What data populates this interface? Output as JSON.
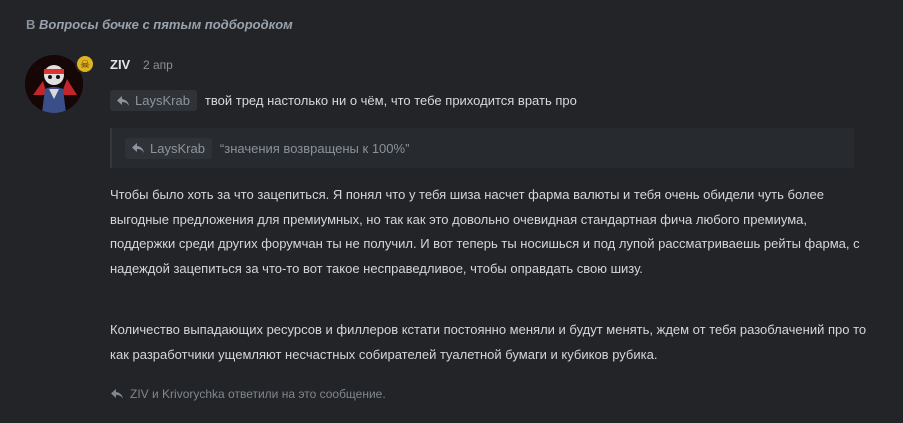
{
  "thread": {
    "prefix": "В",
    "title": "Вопросы бочке с пятым подбородком"
  },
  "post": {
    "author": "ZIV",
    "date": "2 апр",
    "reply_to_user": "LaysKrab",
    "reply_text": "твой тред настолько ни о чём, что тебе приходится врать про",
    "quote": {
      "user": "LaysKrab",
      "text": "“значения возвращены к 100%”"
    },
    "paragraphs": [
      "Чтобы было хоть за что зацепиться. Я понял что у тебя шиза насчет фарма валюты и тебя очень обидели чуть более выгодные предложения для премиумных, но так как это довольно очевидная стандартная фича любого премиума, поддержки среди других форумчан ты не получил. И вот теперь ты носишься и под лупой рассматриваешь рейты фарма, с надеждой зацепиться за что-то вот такое несправедливое, чтобы оправдать свою шизу.",
      "Количество выпадающих ресурсов и филлеров кстати постоянно меняли и будут менять, ждем от тебя разоблачений про то как разработчики ущемляют несчастных собирателей туалетной бумаги и кубиков рубика."
    ],
    "replies_note": "ZIV и Krivorychka ответили на это сообщение."
  },
  "colors": {
    "background": "#222427",
    "badge": "#e0b321",
    "muted": "#8a9099"
  },
  "icons": {
    "badge": "skull-icon",
    "reply": "reply-arrow-icon"
  }
}
